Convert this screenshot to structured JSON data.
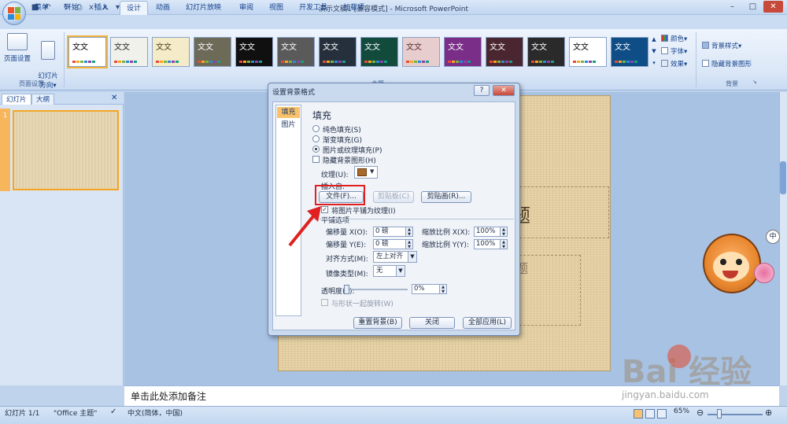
{
  "titlebar": {
    "title": "演示文稿1 [兼容模式] - Microsoft PowerPoint",
    "minimize": "–",
    "maximize": "□",
    "close": "✕"
  },
  "qat": {
    "save": "■",
    "undo": "↶",
    "redo": "↻",
    "print_preview": "⎙",
    "format": "x²",
    "spell": "x",
    "dropdown": "▾"
  },
  "tabs": [
    "菜单",
    "开始",
    "插入",
    "设计",
    "动画",
    "幻灯片放映",
    "审阅",
    "视图",
    "开发工具",
    "加载项"
  ],
  "active_tab": "设计",
  "ribbon": {
    "page_setup_btn": "页面设置",
    "orientation_btn": "幻灯片\n方向▾",
    "page_setup_group": "页面设置",
    "theme_text": "文文",
    "themes_group": "主题",
    "colors": "颜色▾",
    "fonts": "字体▾",
    "effects": "效果▾",
    "bg_styles": "背景样式▾",
    "hide_bg": "隐藏背景图形",
    "bg_group": "背景"
  },
  "themes": [
    {
      "bg": "#ffffff",
      "fg": "#000000"
    },
    {
      "bg": "#f1f1ec",
      "fg": "#222222"
    },
    {
      "bg": "#f4ecc8",
      "fg": "#4a3a1a"
    },
    {
      "bg": "#6d6a58",
      "fg": "#ffffff"
    },
    {
      "bg": "#101010",
      "fg": "#ffffff"
    },
    {
      "bg": "#5a5a5a",
      "fg": "#ffffff"
    },
    {
      "bg": "#26303d",
      "fg": "#ffffff"
    },
    {
      "bg": "#124b3c",
      "fg": "#ffffff"
    },
    {
      "bg": "#e7cdcd",
      "fg": "#5a2a2a"
    },
    {
      "bg": "#7a2e88",
      "fg": "#ffffff"
    },
    {
      "bg": "#4a2630",
      "fg": "#ffffff"
    },
    {
      "bg": "#2a2a2a",
      "fg": "#ffffff"
    },
    {
      "bg": "#ffffff",
      "fg": "#000000"
    },
    {
      "bg": "#0f4d86",
      "fg": "#ffffff"
    }
  ],
  "left_pane": {
    "tab_slides": "幻灯片",
    "tab_outline": "大纲",
    "close": "✕",
    "slide_number": "1"
  },
  "slide": {
    "title_fragment": "题",
    "subtitle_fragment": "题"
  },
  "notes": "单击此处添加备注",
  "dialog": {
    "title": "设置背景格式",
    "help": "?",
    "close": "✕",
    "nav": [
      "填充",
      "图片"
    ],
    "heading": "填充",
    "radio_solid": "纯色填充(S)",
    "radio_gradient": "渐变填充(G)",
    "radio_picture": "图片或纹理填充(P)",
    "check_hide": "隐藏背景图形(H)",
    "texture_label": "纹理(U):",
    "insert_from": "插入自:",
    "btn_file": "文件(F)...",
    "btn_clipboard": "剪贴板(C)",
    "btn_clipart": "剪贴画(R)...",
    "check_tile": "将图片平铺为纹理(I)",
    "tile_options": "平铺选项",
    "offset_x_label": "偏移量 X(O):",
    "offset_x": "0 磅",
    "offset_y_label": "偏移量 Y(E):",
    "offset_y": "0 磅",
    "scale_x_label": "缩放比例 X(X):",
    "scale_x": "100%",
    "scale_y_label": "缩放比例 Y(Y):",
    "scale_y": "100%",
    "align_label": "对齐方式(M):",
    "align_value": "左上对齐",
    "mirror_label": "镜像类型(M):",
    "mirror_value": "无",
    "transparency_label": "透明度(T):",
    "transparency_value": "0%",
    "rotate_label": "与形状一起旋转(W)",
    "btn_reset": "重置背景(B)",
    "btn_close": "关闭",
    "btn_apply_all": "全部应用(L)"
  },
  "status": {
    "slide_info": "幻灯片 1/1",
    "theme": "\"Office 主题\"",
    "language": "中文(简体，中国)",
    "zoom": "65%",
    "zoom_minus": "⊖",
    "zoom_plus": "⊕"
  },
  "watermark": {
    "text": "Bai 经验",
    "sub": "jingyan.baidu.com"
  }
}
